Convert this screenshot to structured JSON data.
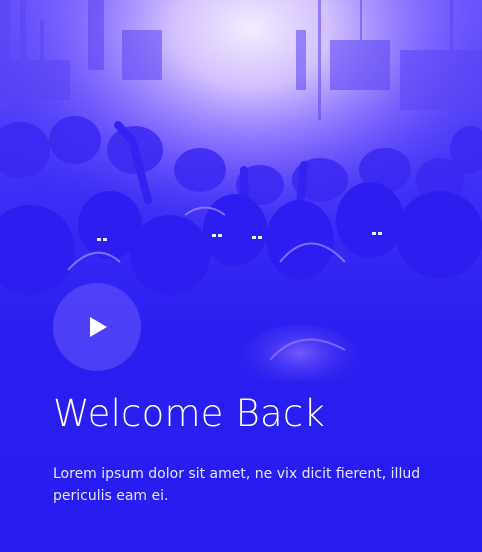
{
  "hero": {
    "background": "concert-crowd-photo",
    "accent_color": "#2a1ff0",
    "highlight_color": "#d9c8ff"
  },
  "play_button": {
    "icon": "play-icon"
  },
  "content": {
    "title": "Welcome Back",
    "description": "Lorem ipsum dolor sit amet, ne vix dicit fierent, illud periculis eam ei."
  }
}
